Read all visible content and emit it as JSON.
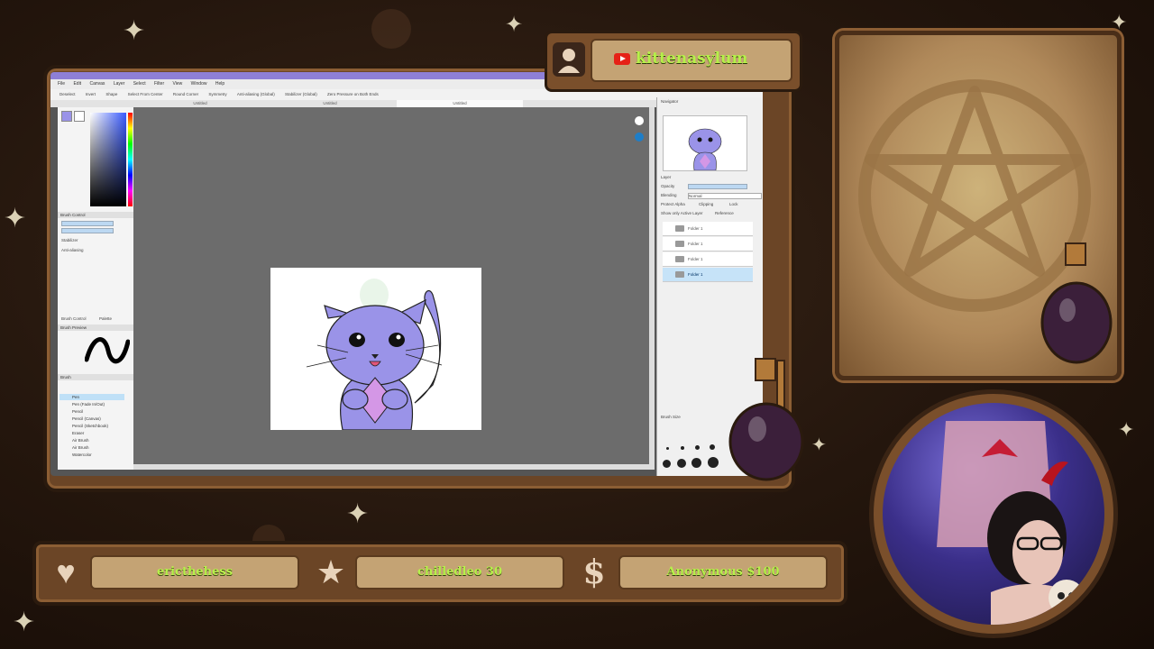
{
  "channel": {
    "platform_icon": "youtube-icon",
    "name": "kittenasylum"
  },
  "app": {
    "menu": [
      "File",
      "Edit",
      "Canvas",
      "Layer",
      "Select",
      "Filter",
      "View",
      "Window",
      "Help"
    ],
    "tabs": [
      "Untitled",
      "Untitled",
      "Untitled"
    ],
    "toolbar": [
      "Deselect",
      "Invert",
      "Shape",
      "Select From Center",
      "Round Corner",
      "Symmetry",
      "Anti-aliasing (Global)",
      "Stabilizer (Global)",
      "Zero Pressure on Both Ends"
    ],
    "left_panel": {
      "brush_control_title": "Brush Control",
      "stabilizer_label": "Stabilizer",
      "anti_aliasing_label": "Anti-aliasing",
      "tabs": [
        "Brush Control",
        "Palette"
      ],
      "brush_preview_title": "Brush Preview",
      "brush_title": "Brush",
      "brushes": [
        "Pen",
        "Pen (Fade In/Out)",
        "Pencil",
        "Pencil (Canvas)",
        "Pencil (Sketchbook)",
        "Eraser",
        "Air Brush",
        "Air Brush",
        "Watercolor"
      ]
    },
    "right_panel": {
      "navigator_title": "Navigator",
      "layer_title": "Layer",
      "opacity_label": "Opacity",
      "blending_label": "Blending",
      "blending_value": "Normal",
      "protect_alpha": "Protect Alpha",
      "clipping": "Clipping",
      "lock": "Lock",
      "show_only_active": "Show only Active Layer",
      "reference": "Reference",
      "layers": [
        "Folder 1",
        "Folder 1",
        "Folder 1",
        "Folder 1"
      ],
      "brush_size_title": "Brush Size"
    }
  },
  "alerts": [
    {
      "icon": "heart-icon",
      "text": "ericthehess"
    },
    {
      "icon": "star-icon",
      "text": "chilledleo 30"
    },
    {
      "icon": "dollar-icon",
      "text": "Anonymous $100"
    }
  ],
  "colors": {
    "frame_brown": "#6b4526",
    "plate_tan": "#c4a374",
    "accent_green": "#b6f04a",
    "cat_purple": "#9a93e8",
    "gem_pink": "#d497e6"
  }
}
